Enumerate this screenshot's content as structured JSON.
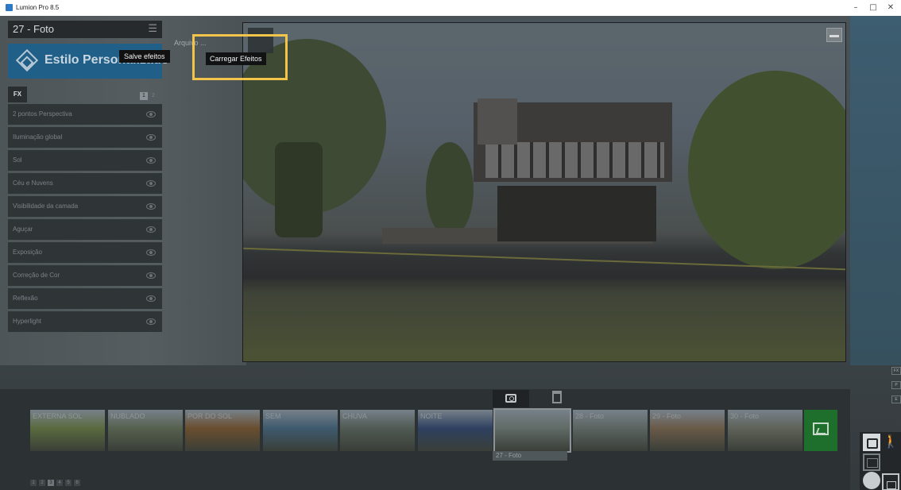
{
  "window": {
    "title": "Lumion Pro 8.5",
    "controls": {
      "minimize": "–",
      "maximize": "□",
      "close": "✕"
    }
  },
  "editor": {
    "photo_name": "27 - Foto",
    "style_button_label": "Estilo Personalizado",
    "save_effects_tooltip": "Salve efeitos",
    "file_label": "Arquivo ...",
    "load_effects_tooltip": "Carregar Efeitos"
  },
  "fx_panel": {
    "tab_label": "FX",
    "pages": [
      "1",
      "2"
    ],
    "active_page": "1",
    "effects": [
      {
        "label": "2 pontos Perspectiva",
        "icon": "eye-icon"
      },
      {
        "label": "Iluminação global",
        "icon": "eye-icon"
      },
      {
        "label": "Sol",
        "icon": "eye-icon"
      },
      {
        "label": "Céu e Nuvens",
        "icon": "eye-icon"
      },
      {
        "label": "Visibilidade da camada",
        "icon": "eye-icon"
      },
      {
        "label": "Aguçar",
        "icon": "eye-icon"
      },
      {
        "label": "Exposição",
        "icon": "eye-icon"
      },
      {
        "label": "Correção de Cor",
        "icon": "eye-icon"
      },
      {
        "label": "Reflexão",
        "icon": "eye-icon"
      },
      {
        "label": "Hyperlight",
        "icon": "eye-icon"
      }
    ]
  },
  "filmstrip": {
    "thumbnails": [
      {
        "label": "EXTERNA SOL",
        "tone": "#5a6a3e"
      },
      {
        "label": "NUBLADO",
        "tone": "#56604e"
      },
      {
        "label": "POR DO SOL",
        "tone": "#6a4e2e"
      },
      {
        "label": "SEM",
        "tone": "#3e5a6e"
      },
      {
        "label": "CHUVA",
        "tone": "#4f5a52"
      },
      {
        "label": "NOITE",
        "tone": "#2e4060"
      },
      {
        "label": "",
        "tone": "#606a66"
      },
      {
        "label": "28 - Foto",
        "tone": "#5b6460"
      },
      {
        "label": "29 - Foto",
        "tone": "#6a5a48"
      },
      {
        "label": "30 - Foto",
        "tone": "#5e6258"
      }
    ],
    "selected_index": 6,
    "selected_caption": "27 - Foto",
    "pages": [
      "1",
      "2",
      "3",
      "4",
      "5",
      "6"
    ],
    "active_page": "3"
  },
  "colors": {
    "accent_highlight": "#f0c54a",
    "style_button": "#1f5f88",
    "gallery_button": "#1e6e2c",
    "help_button": "#1f5c9a"
  },
  "dock": {
    "gear_label": "⚙",
    "help_label": "?",
    "walk_label": "🚶"
  },
  "edge_tabs": [
    "FX",
    "P",
    "E"
  ]
}
